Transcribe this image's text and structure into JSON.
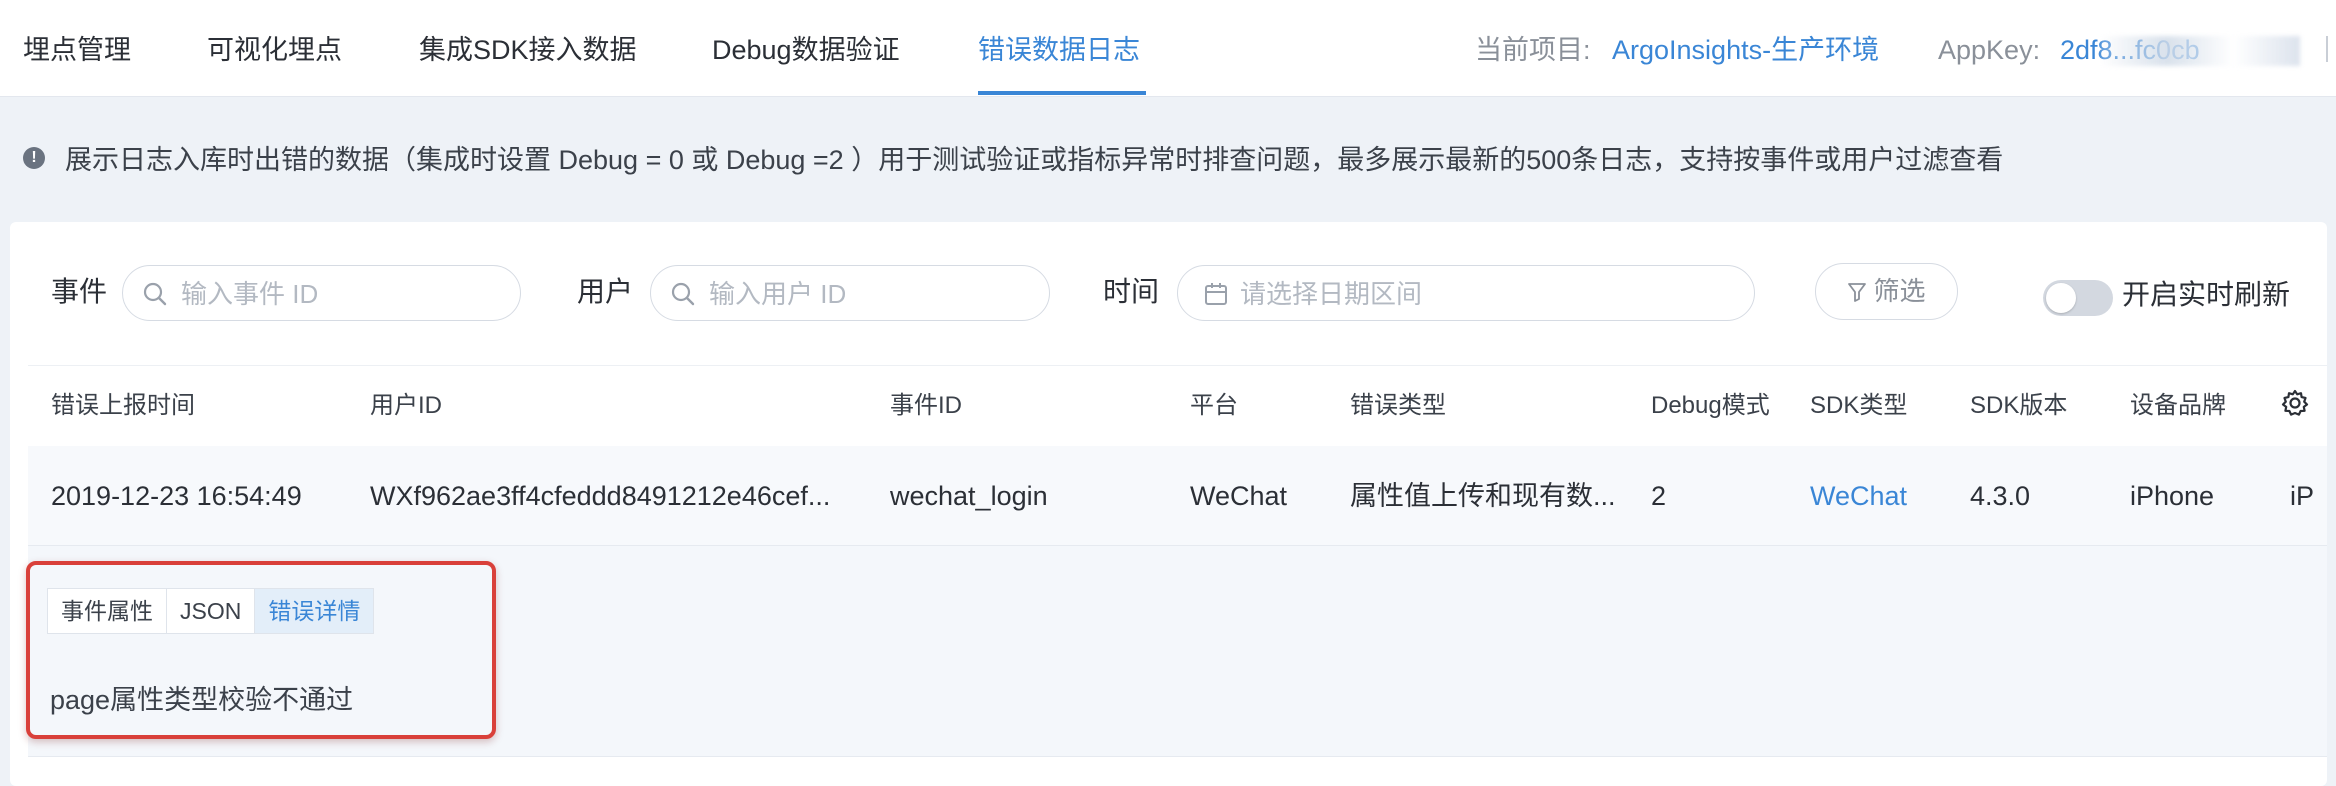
{
  "nav": {
    "tabs": [
      {
        "label": "埋点管理"
      },
      {
        "label": "可视化埋点"
      },
      {
        "label": "集成SDK接入数据"
      },
      {
        "label": "Debug数据验证"
      },
      {
        "label": "错误数据日志"
      }
    ],
    "active_tab": "错误数据日志",
    "project_label": "当前项目:",
    "project_value": "ArgoInsights-生产环境",
    "appkey_label": "AppKey:",
    "appkey_value": "2df8...fc0cb"
  },
  "notice": {
    "icon": "info-icon",
    "text": "展示日志入库时出错的数据（集成时设置 Debug = 0 或 Debug =2 ）用于测试验证或指标异常时排查问题，最多展示最新的500条日志，支持按事件或用户过滤查看"
  },
  "filters": {
    "event_label": "事件",
    "event_placeholder": "输入事件 ID",
    "user_label": "用户",
    "user_placeholder": "输入用户 ID",
    "time_label": "时间",
    "time_placeholder": "请选择日期区间",
    "filter_button": "筛选",
    "realtime_toggle_label": "开启实时刷新",
    "realtime_enabled": false
  },
  "table": {
    "columns": [
      "错误上报时间",
      "用户ID",
      "事件ID",
      "平台",
      "错误类型",
      "Debug模式",
      "SDK类型",
      "SDK版本",
      "设备品牌"
    ],
    "rows": [
      {
        "time": "2019-12-23 16:54:49",
        "user_id": "WXf962ae3ff4cfeddd8491212e46cef...",
        "event_id": "wechat_login",
        "platform": "WeChat",
        "error_type": "属性值上传和现有数...",
        "debug_mode": "2",
        "sdk_type": "WeChat",
        "sdk_version": "4.3.0",
        "device_brand": "iPhone",
        "overflow": "iP"
      }
    ]
  },
  "detail": {
    "tabs": [
      "事件属性",
      "JSON",
      "错误详情"
    ],
    "active_tab": "错误详情",
    "message": "page属性类型校验不通过"
  },
  "colors": {
    "accent": "#3a86d6",
    "highlight": "#d9403a"
  }
}
